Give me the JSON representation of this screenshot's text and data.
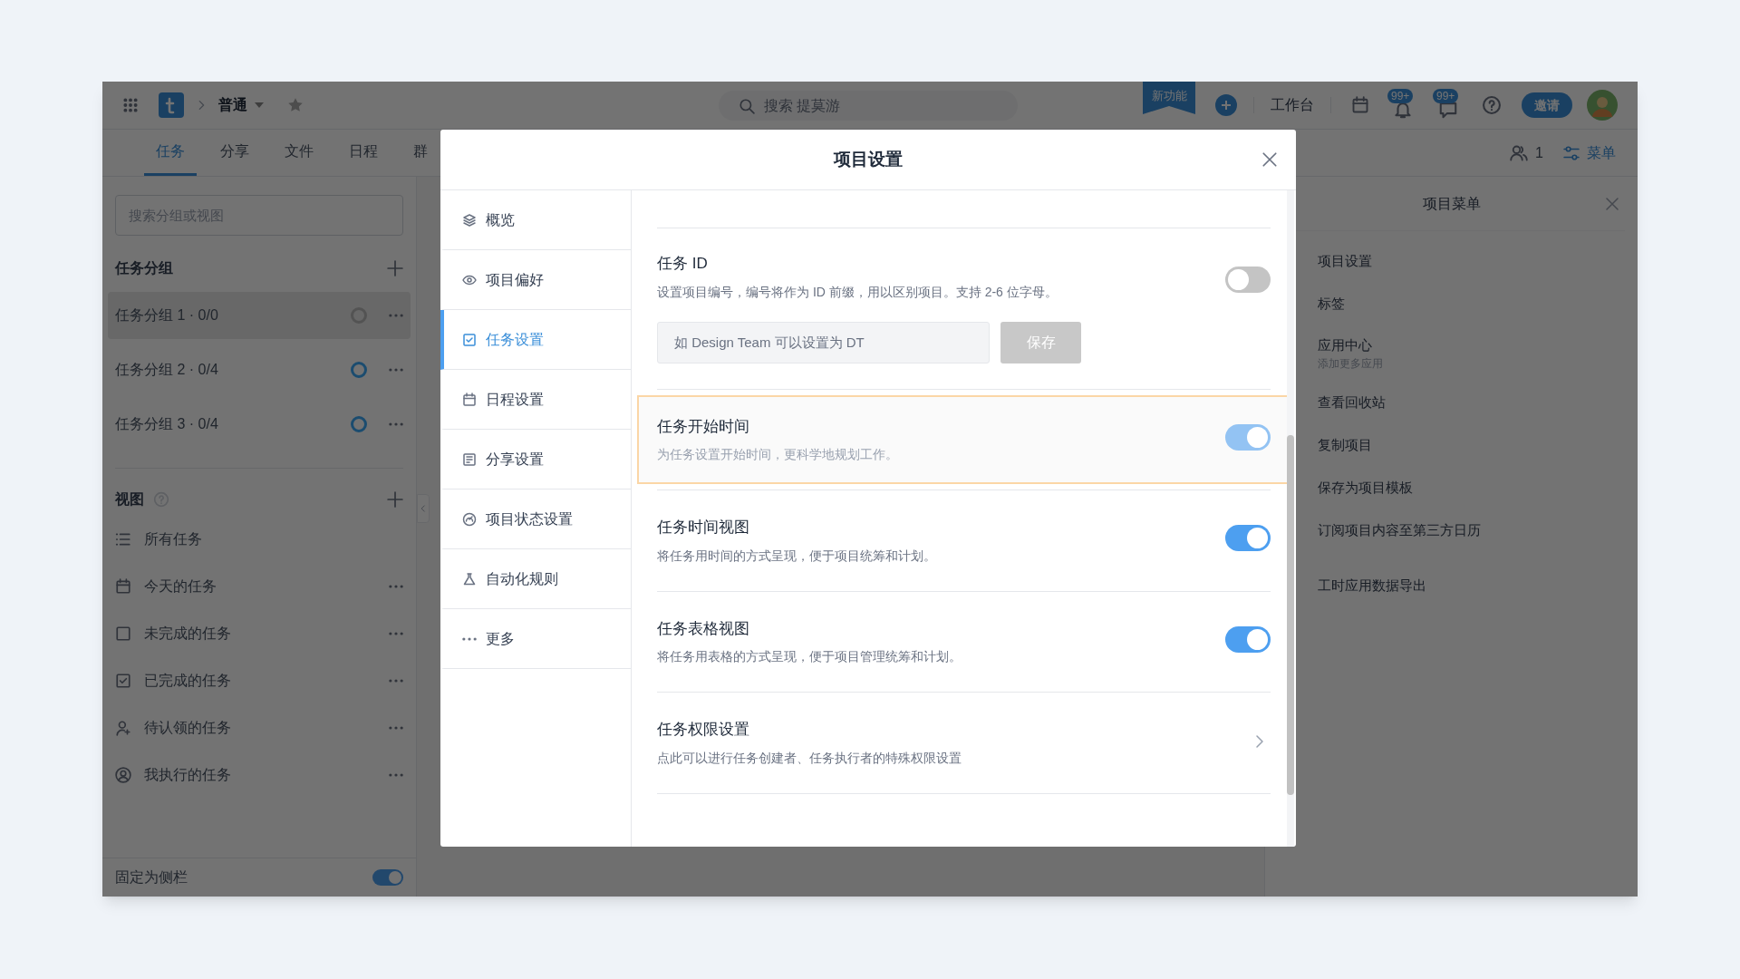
{
  "topbar": {
    "project_name": "普通",
    "search_placeholder": "搜索 提莫游",
    "new_feature": "新功能",
    "workbench": "工作台",
    "badges": [
      "99+",
      "99+"
    ],
    "invite_button": "邀请"
  },
  "tabs": [
    {
      "label": "任务",
      "selected": true
    },
    {
      "label": "分享",
      "selected": false
    },
    {
      "label": "文件",
      "selected": false
    },
    {
      "label": "日程",
      "selected": false
    },
    {
      "label": "群",
      "selected": false
    }
  ],
  "member_count": "1",
  "menu_button": "菜单",
  "sidebar": {
    "search_placeholder": "搜索分组或视图",
    "groups_title": "任务分组",
    "groups": [
      {
        "name": "任务分组 1 · 0/0",
        "selected": true,
        "active": false
      },
      {
        "name": "任务分组 2 · 0/4",
        "selected": false,
        "active": true
      },
      {
        "name": "任务分组 3 · 0/4",
        "selected": false,
        "active": true
      }
    ],
    "views_title": "视图",
    "views": [
      {
        "label": "所有任务",
        "has_menu": false
      },
      {
        "label": "今天的任务",
        "has_menu": true
      },
      {
        "label": "未完成的任务",
        "has_menu": true
      },
      {
        "label": "已完成的任务",
        "has_menu": true
      },
      {
        "label": "待认领的任务",
        "has_menu": true
      },
      {
        "label": "我执行的任务",
        "has_menu": true
      }
    ],
    "pin": {
      "label": "固定为侧栏",
      "on": true
    }
  },
  "right_panel": {
    "title": "项目菜单",
    "items": [
      {
        "label": "项目设置"
      },
      {
        "label": "标签"
      },
      {
        "label": "应用中心",
        "sub": "添加更多应用"
      },
      {
        "label": "查看回收站"
      },
      {
        "label": "复制项目"
      },
      {
        "label": "保存为项目模板"
      },
      {
        "label": "订阅项目内容至第三方日历"
      },
      {
        "label": "工时应用数据导出"
      }
    ]
  },
  "modal": {
    "title": "项目设置",
    "nav": [
      {
        "label": "概览",
        "selected": false
      },
      {
        "label": "项目偏好",
        "selected": false
      },
      {
        "label": "任务设置",
        "selected": true
      },
      {
        "label": "日程设置",
        "selected": false
      },
      {
        "label": "分享设置",
        "selected": false
      },
      {
        "label": "项目状态设置",
        "selected": false
      },
      {
        "label": "自动化规则",
        "selected": false
      },
      {
        "label": "更多",
        "selected": false
      }
    ],
    "sections": [
      {
        "kind": "id",
        "title": "任务 ID",
        "description": "设置项目编号，编号将作为 ID 前缀，用以区别项目。支持 2-6 位字母。",
        "on": false,
        "disabled": false,
        "highlighted": false,
        "placeholder": "如 Design Team 可以设置为 DT",
        "button": "保存"
      },
      {
        "kind": "toggle",
        "title": "任务开始时间",
        "description": "为任务设置开始时间，更科学地规划工作。",
        "on": true,
        "disabled": true,
        "highlighted": true
      },
      {
        "kind": "toggle",
        "title": "任务时间视图",
        "description": "将任务用时间的方式呈现，便于项目统筹和计划。",
        "on": true,
        "disabled": false,
        "highlighted": false
      },
      {
        "kind": "toggle",
        "title": "任务表格视图",
        "description": "将任务用表格的方式呈现，便于项目管理统筹和计划。",
        "on": true,
        "disabled": false,
        "highlighted": false
      },
      {
        "kind": "link",
        "title": "任务权限设置",
        "description": "点此可以进行任务创建者、任务执行者的特殊权限设置",
        "highlighted": false
      }
    ]
  }
}
